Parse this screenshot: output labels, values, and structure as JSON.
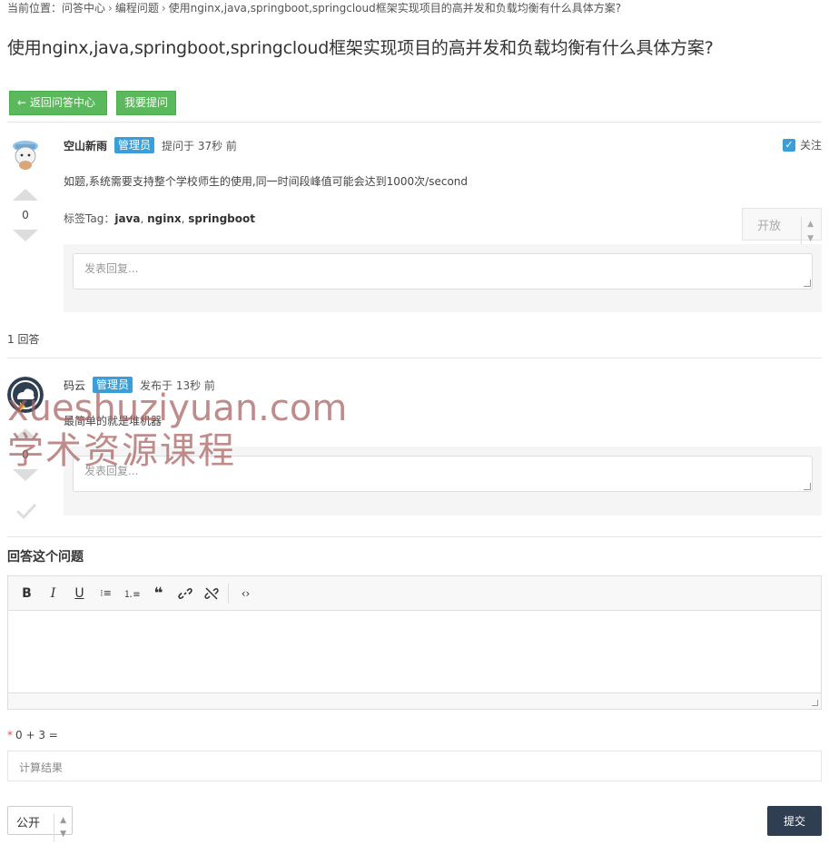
{
  "breadcrumb": {
    "prefix": "当前位置：",
    "items": [
      "问答中心",
      "编程问题",
      "使用nginx,java,springboot,springcloud框架实现项目的高并发和负载均衡有什么具体方案?"
    ]
  },
  "question": {
    "title": "使用nginx,java,springboot,springcloud框架实现项目的高并发和负载均衡有什么具体方案?",
    "author": "空山新雨",
    "role_badge": "管理员",
    "time": "提问于 37秒 前",
    "follow_label": "关注",
    "body": "如题,系统需要支持整个学校师生的使用,同一时间段峰值可能会达到1000次/second",
    "tags_label": "标签Tag：",
    "tags": [
      "java",
      "nginx",
      "springboot"
    ],
    "votes": "0",
    "status": "开放",
    "reply_placeholder": "发表回复..."
  },
  "actions": {
    "back_label": "← 返回问答中心",
    "ask_label": "我要提问"
  },
  "answers": {
    "count_label": "1 回答",
    "items": [
      {
        "author": "码云",
        "role_badge": "管理员",
        "time": "发布于 13秒 前",
        "body": "最简单的就是堆机器",
        "votes": "0",
        "reply_placeholder": "发表回复..."
      }
    ]
  },
  "watermark": {
    "line1": "xueshuziyuan.com",
    "line2": "学术资源课程"
  },
  "answer_form": {
    "title": "回答这个问题",
    "toolbar": [
      {
        "name": "bold-button",
        "glyph": "B"
      },
      {
        "name": "italic-button",
        "glyph": "I"
      },
      {
        "name": "underline-button",
        "glyph": "U"
      },
      {
        "name": "bullet-list-button",
        "glyph": "⁝≡"
      },
      {
        "name": "numbered-list-button",
        "glyph": "⒈≡"
      },
      {
        "name": "quote-button",
        "glyph": "❝"
      },
      {
        "name": "link-button",
        "glyph": "🔗"
      },
      {
        "name": "unlink-button",
        "glyph": "⛓"
      },
      {
        "name": "code-button",
        "glyph": "‹›"
      }
    ],
    "captcha_required": "*",
    "captcha_question": "0 + 3 =",
    "captcha_placeholder": "计算结果",
    "visibility": "公开",
    "submit_label": "提交"
  },
  "colors": {
    "green": "#5cb85c",
    "badge_blue": "#3a9fd8",
    "submit_dark": "#2f3e50"
  }
}
